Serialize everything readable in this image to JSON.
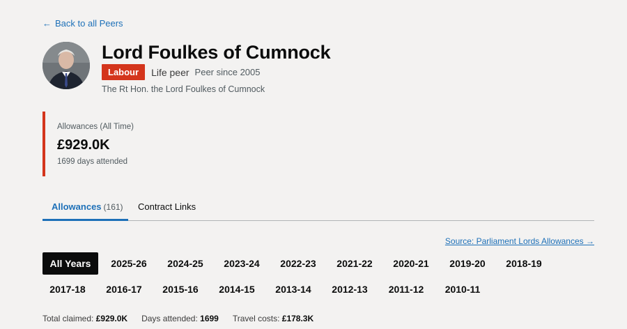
{
  "back_link": {
    "label": "Back to all Peers"
  },
  "peer": {
    "name": "Lord Foulkes of Cumnock",
    "party": "Labour",
    "type": "Life peer",
    "since": "Peer since 2005",
    "full_title": "The Rt Hon. the Lord Foulkes of Cumnock",
    "party_color": "#d4351c"
  },
  "summary": {
    "label": "Allowances (All Time)",
    "value": "£929.0K",
    "days": "1699 days attended"
  },
  "tabs": [
    {
      "label": "Allowances",
      "count": "(161)",
      "active": true
    },
    {
      "label": "Contract Links",
      "active": false
    }
  ],
  "source_link": "Source: Parliament Lords Allowances →",
  "years": [
    "All Years",
    "2025-26",
    "2024-25",
    "2023-24",
    "2022-23",
    "2021-22",
    "2020-21",
    "2019-20",
    "2018-19",
    "2017-18",
    "2016-17",
    "2015-16",
    "2014-15",
    "2013-14",
    "2012-13",
    "2011-12",
    "2010-11"
  ],
  "totals": {
    "claimed_label": "Total claimed:",
    "claimed_value": "£929.0K",
    "days_label": "Days attended:",
    "days_value": "1699",
    "travel_label": "Travel costs:",
    "travel_value": "£178.3K"
  },
  "colors": {
    "accent": "#1d70b8",
    "party": "#d4351c",
    "active_year_bg": "#0b0c0c"
  }
}
